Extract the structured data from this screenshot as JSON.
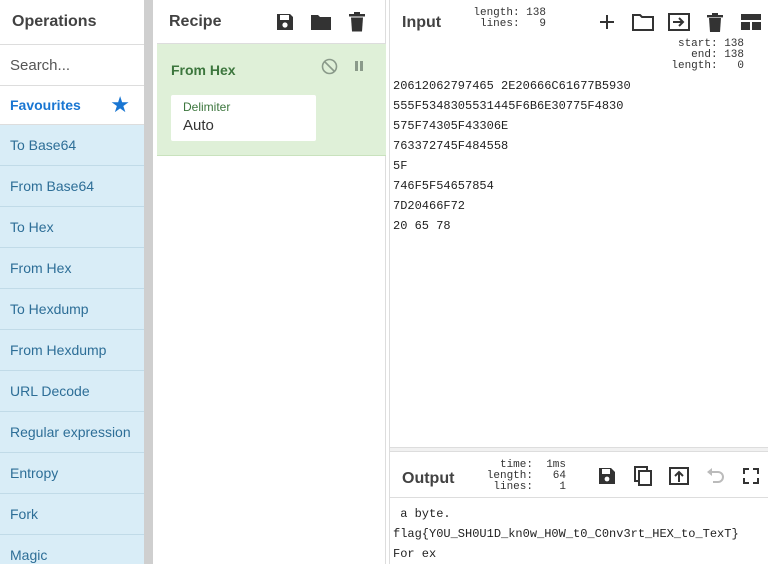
{
  "operations": {
    "title": "Operations",
    "search_placeholder": "Search...",
    "favourites_label": "Favourites",
    "items": [
      "To Base64",
      "From Base64",
      "To Hex",
      "From Hex",
      "To Hexdump",
      "From Hexdump",
      "URL Decode",
      "Regular expression",
      "Entropy",
      "Fork",
      "Magic"
    ]
  },
  "recipe": {
    "title": "Recipe",
    "icons": [
      "save-icon",
      "folder-icon",
      "trash-icon"
    ],
    "operation": {
      "name": "From Hex",
      "arg_label": "Delimiter",
      "arg_value": "Auto"
    }
  },
  "input": {
    "title": "Input",
    "stats": "length: 138\n lines:   9",
    "selection": "start: 138\n  end: 138\nlength:   0",
    "lines": [
      "20612062797465 2E20666C61677B5930",
      "555F5348305531445F6B6E30775F4830",
      "575F74305F43306E",
      "763372745F484558",
      "5F",
      "746F5F54657854",
      "7D20466F72",
      "20 65 78"
    ]
  },
  "output": {
    "title": "Output",
    "stats": "time:  1ms\nlength:   64\n lines:    1",
    "lines": [
      " a byte.",
      "flag{Y0U_SH0U1D_kn0w_H0W_t0_C0nv3rt_HEX_to_TexT}",
      "For ex"
    ]
  },
  "colors": {
    "favourite_blue": "#1976d2",
    "op_list_bg": "#d9edf7",
    "recipe_card_bg": "#dff0d8"
  }
}
